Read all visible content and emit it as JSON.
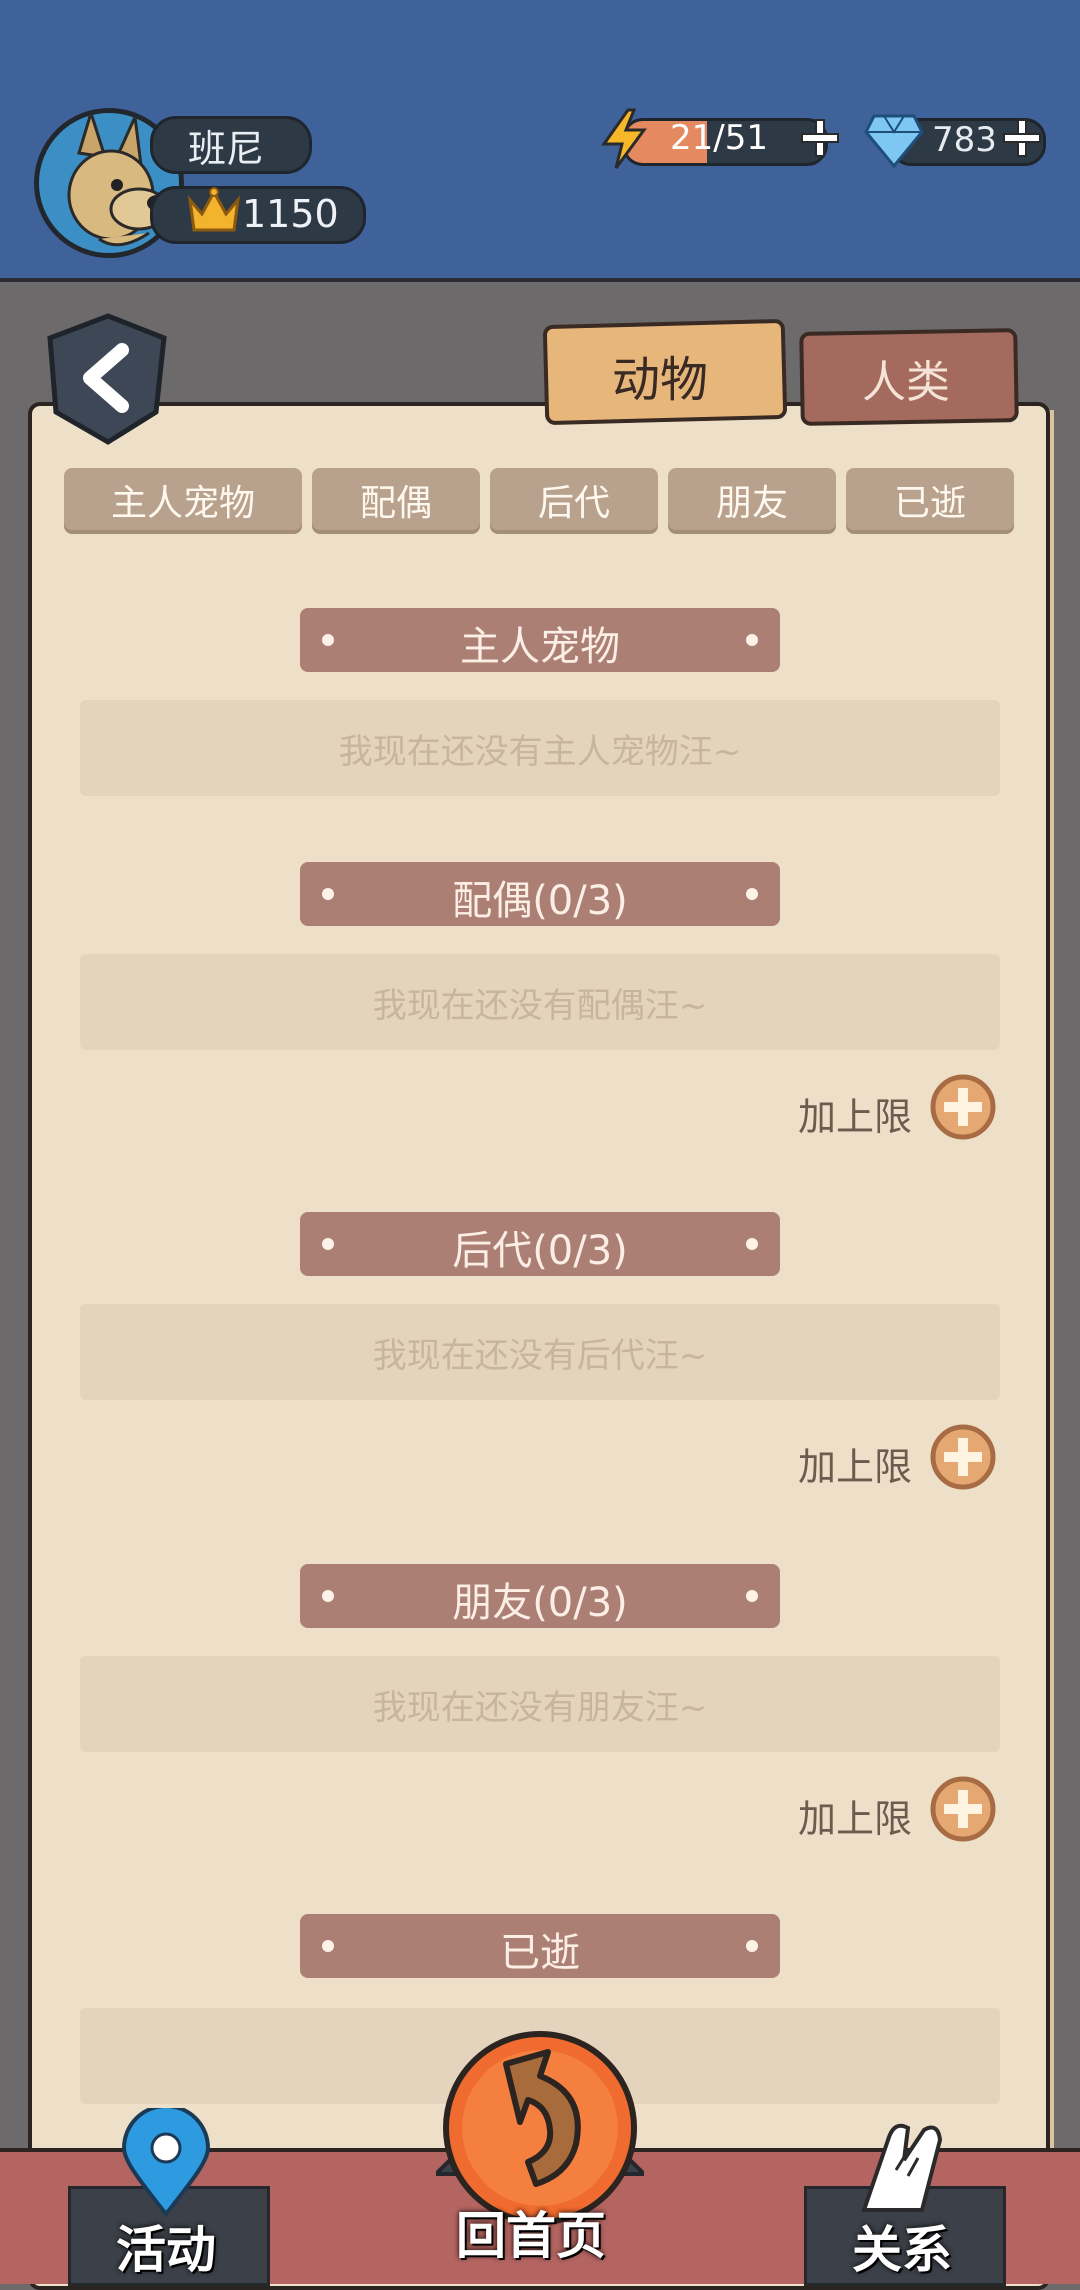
{
  "profile": {
    "name": "班尼",
    "score": "1150",
    "energy_text": "21/51",
    "energy_fraction": 0.41,
    "gems": "783"
  },
  "tabs": {
    "animal": "动物",
    "human": "人类"
  },
  "subtabs": [
    "主人宠物",
    "配偶",
    "后代",
    "朋友",
    "已逝"
  ],
  "sections": [
    {
      "title": "主人宠物",
      "empty": "我现在还没有主人宠物汪~"
    },
    {
      "title": "配偶(0/3)",
      "empty": "我现在还没有配偶汪~",
      "limit": "加上限"
    },
    {
      "title": "后代(0/3)",
      "empty": "我现在还没有后代汪~",
      "limit": "加上限"
    },
    {
      "title": "朋友(0/3)",
      "empty": "我现在还没有朋友汪~",
      "limit": "加上限"
    },
    {
      "title": "已逝",
      "empty": ""
    }
  ],
  "nav": {
    "activity": "活动",
    "home": "回首页",
    "relation": "关系"
  },
  "icons": {
    "avatar": "dog-avatar-icon",
    "crown": "crown-icon",
    "energy": "lightning-icon",
    "gem": "diamond-icon",
    "plus": "plus-icon",
    "back": "back-arrow-icon",
    "activity": "map-pin-icon",
    "home": "return-arrow-icon",
    "relation": "handshake-icon"
  },
  "colors": {
    "header": "#3e6299",
    "paper": "#eee0c8",
    "section_header": "#ac7f74",
    "energy_fill": "#e58a60",
    "nav_bar": "#b56561"
  }
}
